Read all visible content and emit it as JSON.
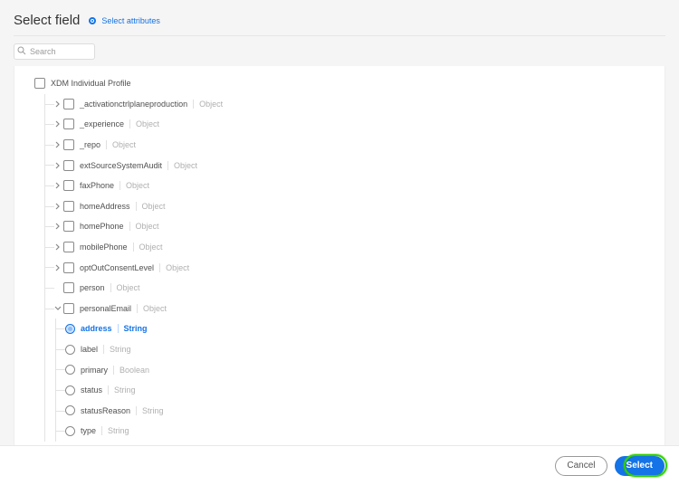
{
  "header": {
    "title": "Select field",
    "breadcrumb_label": "Select attributes"
  },
  "search": {
    "placeholder": "Search"
  },
  "root": {
    "label": "XDM Individual Profile"
  },
  "children": [
    {
      "label": "_activationctrlplaneproduction",
      "type": "Object",
      "expandable": true
    },
    {
      "label": "_experience",
      "type": "Object",
      "expandable": true
    },
    {
      "label": "_repo",
      "type": "Object",
      "expandable": true
    },
    {
      "label": "extSourceSystemAudit",
      "type": "Object",
      "expandable": true
    },
    {
      "label": "faxPhone",
      "type": "Object",
      "expandable": true
    },
    {
      "label": "homeAddress",
      "type": "Object",
      "expandable": true
    },
    {
      "label": "homePhone",
      "type": "Object",
      "expandable": true
    },
    {
      "label": "mobilePhone",
      "type": "Object",
      "expandable": true
    },
    {
      "label": "optOutConsentLevel",
      "type": "Object",
      "expandable": true
    },
    {
      "label": "person",
      "type": "Object",
      "expandable": false
    },
    {
      "label": "personalEmail",
      "type": "Object",
      "expandable": false,
      "expanded": true
    }
  ],
  "personalEmailFields": [
    {
      "label": "address",
      "type": "String",
      "selected": true
    },
    {
      "label": "label",
      "type": "String"
    },
    {
      "label": "primary",
      "type": "Boolean"
    },
    {
      "label": "status",
      "type": "String"
    },
    {
      "label": "statusReason",
      "type": "String"
    },
    {
      "label": "type",
      "type": "String"
    }
  ],
  "footer": {
    "cancel": "Cancel",
    "select": "Select"
  }
}
